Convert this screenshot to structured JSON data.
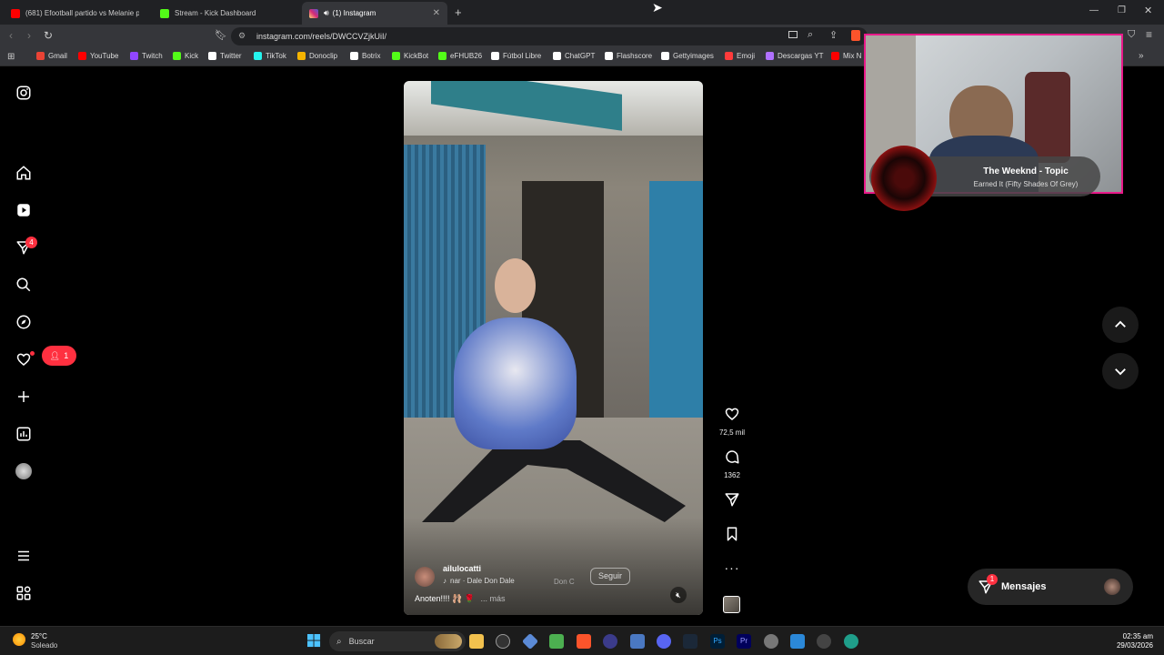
{
  "tabs": [
    {
      "title": "(681) Efootball partido vs Melanie pa",
      "color": "#ff0000"
    },
    {
      "title": "Stream - Kick Dashboard",
      "color": "#53fc18"
    },
    {
      "title": "(1) Instagram",
      "color": "#e1306c"
    }
  ],
  "url": "instagram.com/reels/DWCCVZjkUiI/",
  "bookmarks": [
    {
      "label": "Gmail",
      "color": "#ea4335"
    },
    {
      "label": "YouTube",
      "color": "#ff0000"
    },
    {
      "label": "Twitch",
      "color": "#9146ff"
    },
    {
      "label": "Kick",
      "color": "#53fc18"
    },
    {
      "label": "Twitter",
      "color": "#ffffff"
    },
    {
      "label": "TikTok",
      "color": "#25f4ee"
    },
    {
      "label": "Donoclip",
      "color": "#f5b400"
    },
    {
      "label": "Botrix",
      "color": "#ffffff"
    },
    {
      "label": "KickBot",
      "color": "#53fc18"
    },
    {
      "label": "eFHUB26",
      "color": "#53fc18"
    },
    {
      "label": "Fútbol Libre",
      "color": "#ffffff"
    },
    {
      "label": "ChatGPT",
      "color": "#ffffff"
    },
    {
      "label": "Flashscore",
      "color": "#ffffff"
    },
    {
      "label": "Gettyimages",
      "color": "#ffffff"
    },
    {
      "label": "Emoji",
      "color": "#ff3b3b"
    },
    {
      "label": "Descargas YT",
      "color": "#b071ff"
    },
    {
      "label": "Mix N",
      "color": "#ff0000"
    }
  ],
  "sidebar": {
    "messages_badge": "4",
    "notifications_badge": "1"
  },
  "reel": {
    "username": "ailulocatti",
    "follow": "Seguir",
    "audio": "nar · Dale Don Dale",
    "audio2": "Don C",
    "caption": "Anoten!!!! 🩰 🌹",
    "more": "... más",
    "likes": "72,5 mil",
    "comments": "1362"
  },
  "music": {
    "artist": "The Weeknd - Topic",
    "song": "Earned It (Fifty Shades Of Grey)"
  },
  "messages": {
    "label": "Mensajes",
    "badge": "1"
  },
  "taskbar": {
    "weather_temp": "25°C",
    "weather_desc": "Soleado",
    "search": "Buscar",
    "time": "02:35 am",
    "date": "29/03/2026"
  }
}
